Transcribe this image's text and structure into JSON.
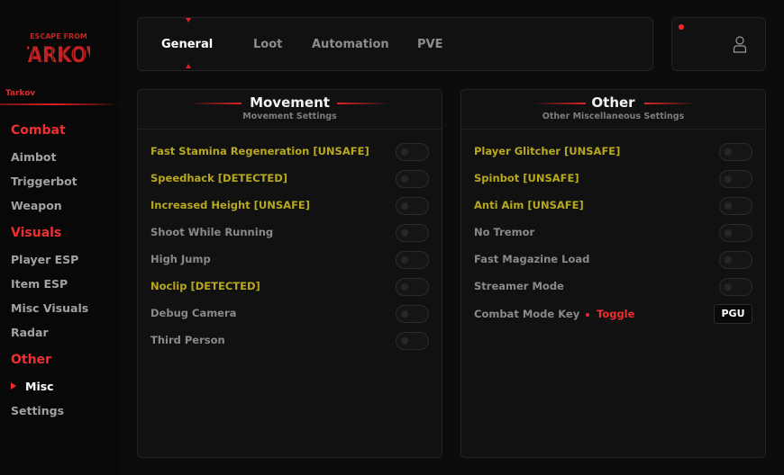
{
  "colors": {
    "accent": "#e02020",
    "warning": "#b8a81c",
    "dim": "#8a8a8a",
    "panel": "#111112"
  },
  "sidebar": {
    "logo": "Escape from Tarkov",
    "brand": "Tarkov",
    "sections": [
      {
        "title": "Combat",
        "items": [
          "Aimbot",
          "Triggerbot",
          "Weapon"
        ]
      },
      {
        "title": "Visuals",
        "items": [
          "Player ESP",
          "Item ESP",
          "Misc Visuals",
          "Radar"
        ]
      },
      {
        "title": "Other",
        "items": [
          "Misc",
          "Settings"
        ]
      }
    ],
    "active_item": "Misc"
  },
  "tabs": {
    "items": [
      "General",
      "Loot",
      "Automation",
      "PVE"
    ],
    "active": "General"
  },
  "user": {
    "icon": "user-icon",
    "notification": "notification-dot"
  },
  "movement": {
    "title": "Movement",
    "subtitle": "Movement Settings",
    "options": [
      {
        "label": "Fast Stamina Regeneration [UNSAFE]",
        "enabled": false
      },
      {
        "label": "Speedhack [DETECTED]",
        "enabled": false
      },
      {
        "label": "Increased Height [UNSAFE]",
        "enabled": false
      },
      {
        "label": "Shoot While Running",
        "enabled": false
      },
      {
        "label": "High Jump",
        "enabled": false
      },
      {
        "label": "Noclip [DETECTED]",
        "enabled": false
      },
      {
        "label": "Debug Camera",
        "enabled": false
      },
      {
        "label": "Third Person",
        "enabled": false
      }
    ]
  },
  "other": {
    "title": "Other",
    "subtitle": "Other Miscellaneous Settings",
    "options": [
      {
        "label": "Player Glitcher [UNSAFE]",
        "enabled": false
      },
      {
        "label": "Spinbot [UNSAFE]",
        "enabled": false
      },
      {
        "label": "Anti Aim [UNSAFE]",
        "enabled": false
      },
      {
        "label": "No Tremor",
        "enabled": false
      },
      {
        "label": "Fast Magazine Load",
        "enabled": false
      },
      {
        "label": "Streamer Mode",
        "enabled": false
      }
    ],
    "keybind": {
      "label": "Combat Mode Key",
      "mode": "Toggle",
      "key": "PGU"
    }
  }
}
